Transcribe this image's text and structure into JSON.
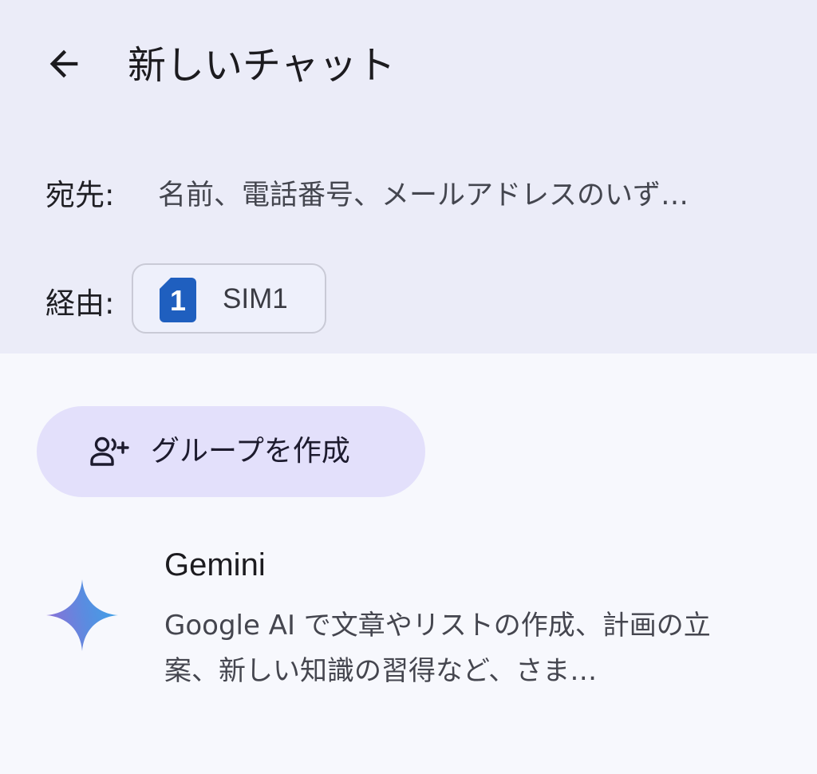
{
  "header": {
    "title": "新しいチャット",
    "back_icon": "arrow-back-icon"
  },
  "recipient": {
    "label": "宛先:",
    "placeholder": "名前、電話番号、メールアドレスのいず…"
  },
  "via": {
    "label": "経由:",
    "sim_number": "1",
    "sim_label": "SIM1",
    "sim_icon": "sim-card-icon",
    "sim_color": "#1f5fbf"
  },
  "group_button": {
    "label": "グループを作成",
    "icon": "add-group-icon",
    "background": "#e3e0fb"
  },
  "suggestion": {
    "name": "Gemini",
    "description": "Google AI で文章やリストの作成、計画の立案、新しい知識の習得など、さま…",
    "icon": "gemini-sparkle-icon"
  },
  "colors": {
    "top_background": "#ebecf8",
    "page_background": "#f7f8fd"
  }
}
